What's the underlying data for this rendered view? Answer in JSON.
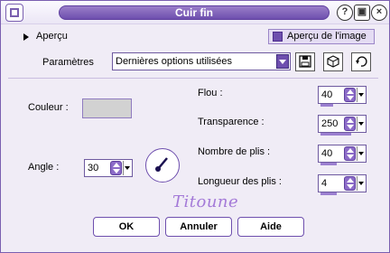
{
  "window": {
    "title": "Cuir fin"
  },
  "titlebar_icons": [
    "help-icon",
    "monitor-icon",
    "close-icon"
  ],
  "preview": {
    "label": "Aperçu",
    "image_preview_label": "Aperçu de l'image"
  },
  "parameters": {
    "label": "Paramètres",
    "selected_value": "Dernières options utilisées",
    "icons": [
      "save-icon",
      "cube-icon",
      "reset-icon"
    ]
  },
  "settings": {
    "color_label": "Couleur :",
    "color_value": "#d2d2d2",
    "angle_label": "Angle :",
    "angle_value": "30",
    "fields": [
      {
        "label": "Flou :",
        "value": "40"
      },
      {
        "label": "Transparence :",
        "value": "250"
      },
      {
        "label": "Nombre de plis :",
        "value": "40"
      },
      {
        "label": "Longueur des plis :",
        "value": "4"
      }
    ]
  },
  "signature": "Titoune",
  "buttons": {
    "ok": "OK",
    "cancel": "Annuler",
    "help": "Aide"
  },
  "colors": {
    "accent": "#6e4fae",
    "background": "#f0ecf6"
  }
}
